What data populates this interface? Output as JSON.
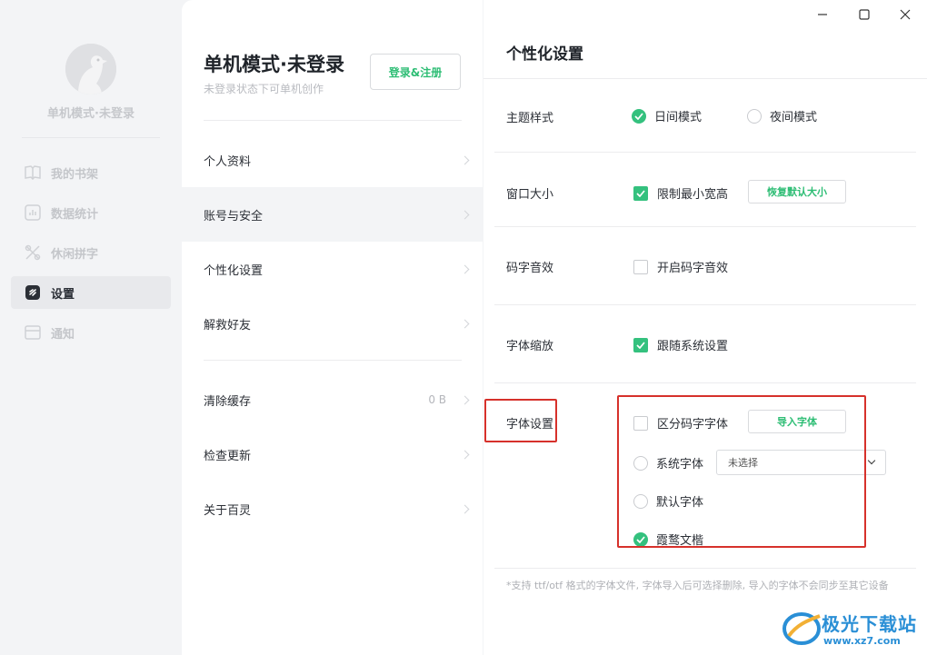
{
  "sidebar": {
    "user_name": "单机模式·未登录",
    "items": [
      {
        "label": "我的书架",
        "icon": "book-icon",
        "active": false
      },
      {
        "label": "数据统计",
        "icon": "chart-icon",
        "active": false
      },
      {
        "label": "休闲拼字",
        "icon": "puzzle-icon",
        "active": false
      },
      {
        "label": "设置",
        "icon": "settings-icon",
        "active": true
      },
      {
        "label": "通知",
        "icon": "mail-icon",
        "active": false
      }
    ]
  },
  "account": {
    "title": "单机模式·未登录",
    "subtitle": "未登录状态下可单机创作",
    "login_label": "登录&注册"
  },
  "menu": {
    "items": [
      {
        "label": "个人资料"
      },
      {
        "label": "账号与安全",
        "active": true
      },
      {
        "label": "个性化设置"
      },
      {
        "label": "解救好友"
      },
      {
        "label": "清除缓存",
        "value": "0 B"
      },
      {
        "label": "检查更新"
      },
      {
        "label": "关于百灵"
      }
    ]
  },
  "settings": {
    "title": "个性化设置",
    "theme": {
      "label": "主题样式",
      "options": [
        {
          "label": "日间模式",
          "selected": true
        },
        {
          "label": "夜间模式",
          "selected": false
        }
      ]
    },
    "window": {
      "label": "窗口大小",
      "limit_label": "限制最小宽高",
      "limit_checked": true,
      "reset_label": "恢复默认大小"
    },
    "sound": {
      "label": "码字音效",
      "option_label": "开启码字音效",
      "checked": false
    },
    "scale": {
      "label": "字体缩放",
      "option_label": "跟随系统设置",
      "checked": true
    },
    "font": {
      "label": "字体设置",
      "distinguish_label": "区分码字字体",
      "distinguish_checked": false,
      "import_label": "导入字体",
      "system_font_label": "系统字体",
      "system_font_value": "未选择",
      "default_font_label": "默认字体",
      "custom_font_label": "霞鹜文楷",
      "selected": "霞鹜文楷"
    },
    "footnote": "*支持 ttf/otf 格式的字体文件, 字体导入后可选择删除, 导入的字体不会同步至其它设备"
  },
  "watermark": {
    "name": "极光下载站",
    "url": "www.xz7.com"
  },
  "colors": {
    "accent": "#34c17e",
    "highlight": "#d6312b",
    "sidebar_bg": "#f3f4f6"
  }
}
